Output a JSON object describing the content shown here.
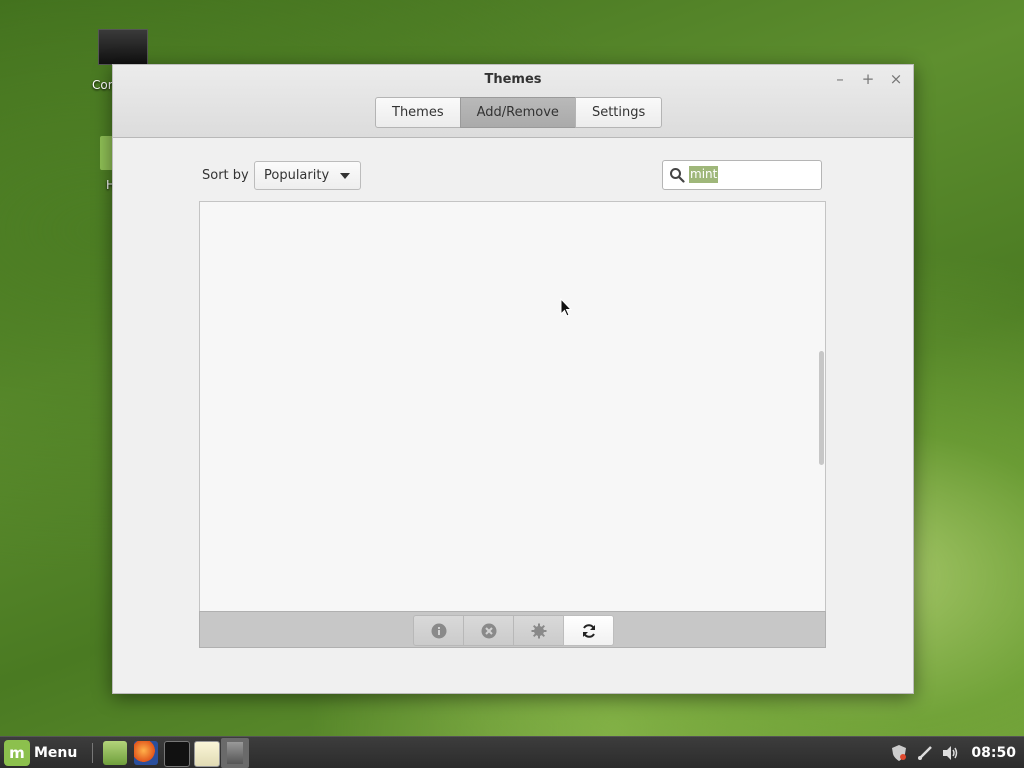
{
  "desktop": {
    "icon1_label": "Cor",
    "icon2_label": "H"
  },
  "window": {
    "title": "Themes",
    "controls": {
      "minimize": "–",
      "maximize": "+",
      "close": "×"
    },
    "tabs": [
      {
        "label": "Themes",
        "active": false
      },
      {
        "label": "Add/Remove",
        "active": true
      },
      {
        "label": "Settings",
        "active": false
      }
    ]
  },
  "toolbar": {
    "sort_label": "Sort by",
    "sort_value": "Popularity",
    "search_value": "mint",
    "search_icon": "search-icon"
  },
  "bottom_toolbar": {
    "buttons": [
      {
        "icon": "info-icon"
      },
      {
        "icon": "uninstall-icon"
      },
      {
        "icon": "configure-icon"
      },
      {
        "icon": "refresh-icon"
      }
    ]
  },
  "taskbar": {
    "menu_label": "Menu",
    "clock": "08:50",
    "launchers": [
      "files-icon",
      "firefox-icon",
      "terminal-icon",
      "text-editor-icon"
    ]
  },
  "colors": {
    "active_tab": "#aaaaaa",
    "selection": "#9fb77a",
    "mint_green": "#8cc04d"
  }
}
